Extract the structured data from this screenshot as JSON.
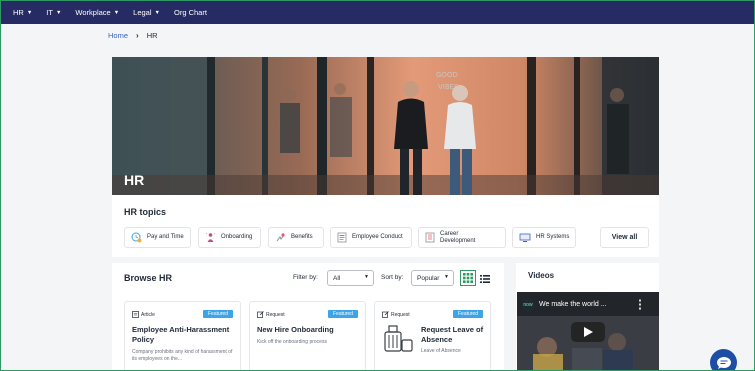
{
  "nav": {
    "items": [
      {
        "label": "HR",
        "dropdown": true
      },
      {
        "label": "IT",
        "dropdown": true
      },
      {
        "label": "Workplace",
        "dropdown": true
      },
      {
        "label": "Legal",
        "dropdown": true
      },
      {
        "label": "Org Chart",
        "dropdown": false
      }
    ]
  },
  "breadcrumb": {
    "home": "Home",
    "current": "HR"
  },
  "hero": {
    "title": "HR"
  },
  "topics": {
    "title": "HR topics",
    "items": [
      {
        "label": "Pay and Time",
        "icon": "clock-coins-icon"
      },
      {
        "label": "Onboarding",
        "icon": "person-sparkle-icon"
      },
      {
        "label": "Benefits",
        "icon": "benefits-icon"
      },
      {
        "label": "Employee Conduct",
        "icon": "document-icon"
      },
      {
        "label": "Career Development",
        "icon": "ladder-icon"
      },
      {
        "label": "HR Systems",
        "icon": "monitor-icon"
      }
    ],
    "view_all": "View all"
  },
  "browse": {
    "title": "Browse HR",
    "filter_label": "Filter by:",
    "filter_value": "All",
    "sort_label": "Sort by:",
    "sort_value": "Popular",
    "cards": [
      {
        "type": "Article",
        "badge": "Featured",
        "title": "Employee Anti-Harassment Policy",
        "desc": "Company prohibits any kind of harassment of its employees on the..."
      },
      {
        "type": "Request",
        "badge": "Featured",
        "title": "New Hire Onboarding",
        "desc": "Kick off the onboarding process"
      },
      {
        "type": "Request",
        "badge": "Featured",
        "title": "Request Leave of Absence",
        "desc": "Leave of Absence"
      }
    ]
  },
  "videos": {
    "title": "Videos",
    "video_title": "We make the world ...",
    "channel": "now"
  },
  "colors": {
    "nav_bg": "#262b63",
    "accent": "#2e9a63",
    "link": "#3a63c6",
    "badge": "#3ea4e6",
    "chat": "#1f4fa5"
  }
}
